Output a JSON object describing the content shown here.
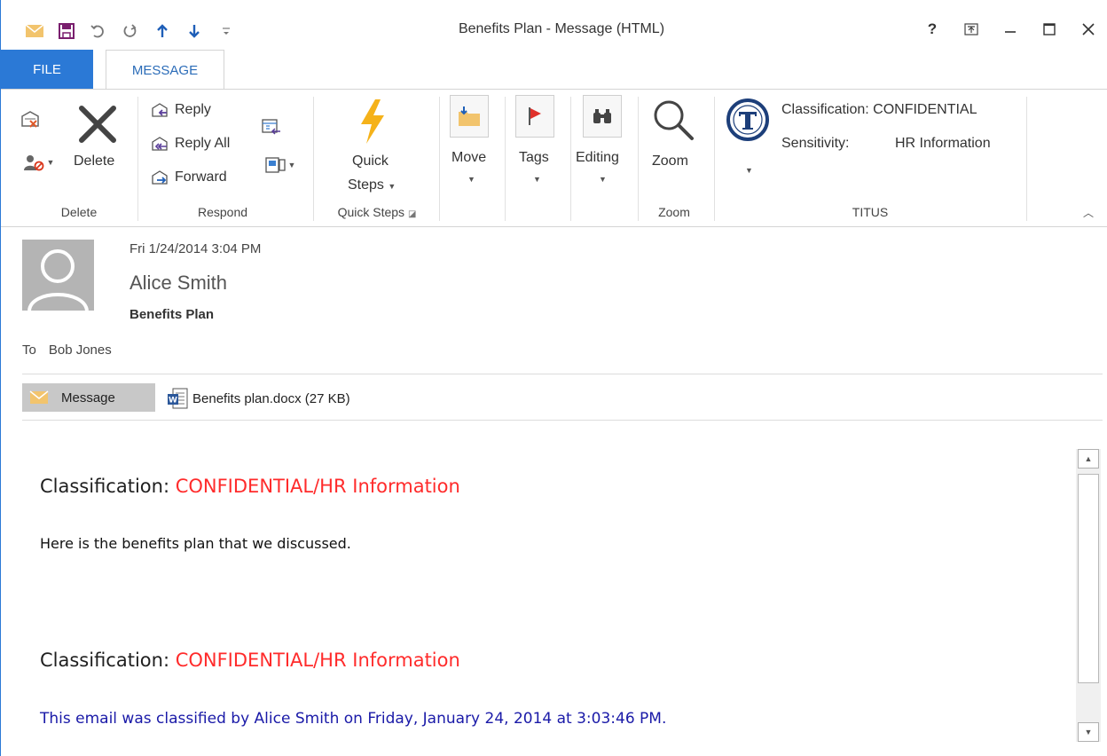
{
  "window": {
    "title": "Benefits Plan - Message (HTML)",
    "accent_color": "#2b79d6"
  },
  "qat": {
    "icons": [
      "envelope-icon",
      "save-icon",
      "undo-icon",
      "redo-icon",
      "up-arrow-icon",
      "down-arrow-icon",
      "customize-icon"
    ]
  },
  "window_controls": {
    "help": "?",
    "icons": [
      "help-icon",
      "ribbon-display-icon",
      "minimize-icon",
      "maximize-icon",
      "close-icon"
    ]
  },
  "tabs": {
    "file": "FILE",
    "message": "MESSAGE"
  },
  "ribbon": {
    "delete_group": {
      "delete": "Delete",
      "label": "Delete"
    },
    "respond_group": {
      "reply": "Reply",
      "reply_all": "Reply All",
      "forward": "Forward",
      "label": "Respond"
    },
    "quick_steps_group": {
      "line1": "Quick",
      "line2": "Steps",
      "label": "Quick Steps"
    },
    "move": "Move",
    "tags": "Tags",
    "editing": "Editing",
    "zoom_group": {
      "zoom": "Zoom",
      "label": "Zoom"
    },
    "titus_group": {
      "classification_label": "Classification:",
      "classification_value": "CONFIDENTIAL",
      "sensitivity_label": "Sensitivity:",
      "sensitivity_value": "HR Information",
      "label": "TITUS"
    }
  },
  "message": {
    "date": "Fri 1/24/2014 3:04 PM",
    "from": "Alice Smith",
    "subject": "Benefits Plan",
    "to_label": "To",
    "to": "Bob Jones",
    "message_tab": "Message",
    "attachment": "Benefits plan.docx (27 KB)"
  },
  "body": {
    "classification_prefix": "Classification: ",
    "classification_value": "CONFIDENTIAL/HR Information",
    "paragraph": "Here is the benefits plan that we discussed.",
    "classified_note": "This email was classified by Alice Smith on Friday, January 24, 2014 at 3:03:46 PM.",
    "classification_color": "#ff2b2b",
    "note_color": "#1a1aa8"
  }
}
